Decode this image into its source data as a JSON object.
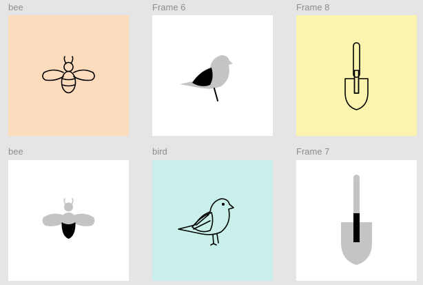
{
  "canvas": {
    "background_color": "#e5e5e5",
    "label_color": "#8d8d8d",
    "frames": [
      {
        "label": "bee",
        "background": "#fddcbd",
        "icon": "bee-outline-icon"
      },
      {
        "label": "Frame 6",
        "background": "#ffffff",
        "icon": "bird-filled-icon"
      },
      {
        "label": "Frame 8",
        "background": "#fbf4ae",
        "icon": "trowel-outline-icon"
      },
      {
        "label": "bee",
        "background": "#ffffff",
        "icon": "bee-filled-icon"
      },
      {
        "label": "bird",
        "background": "#c8efea",
        "icon": "bird-outline-icon"
      },
      {
        "label": "Frame 7",
        "background": "#ffffff",
        "icon": "trowel-filled-icon"
      }
    ]
  }
}
